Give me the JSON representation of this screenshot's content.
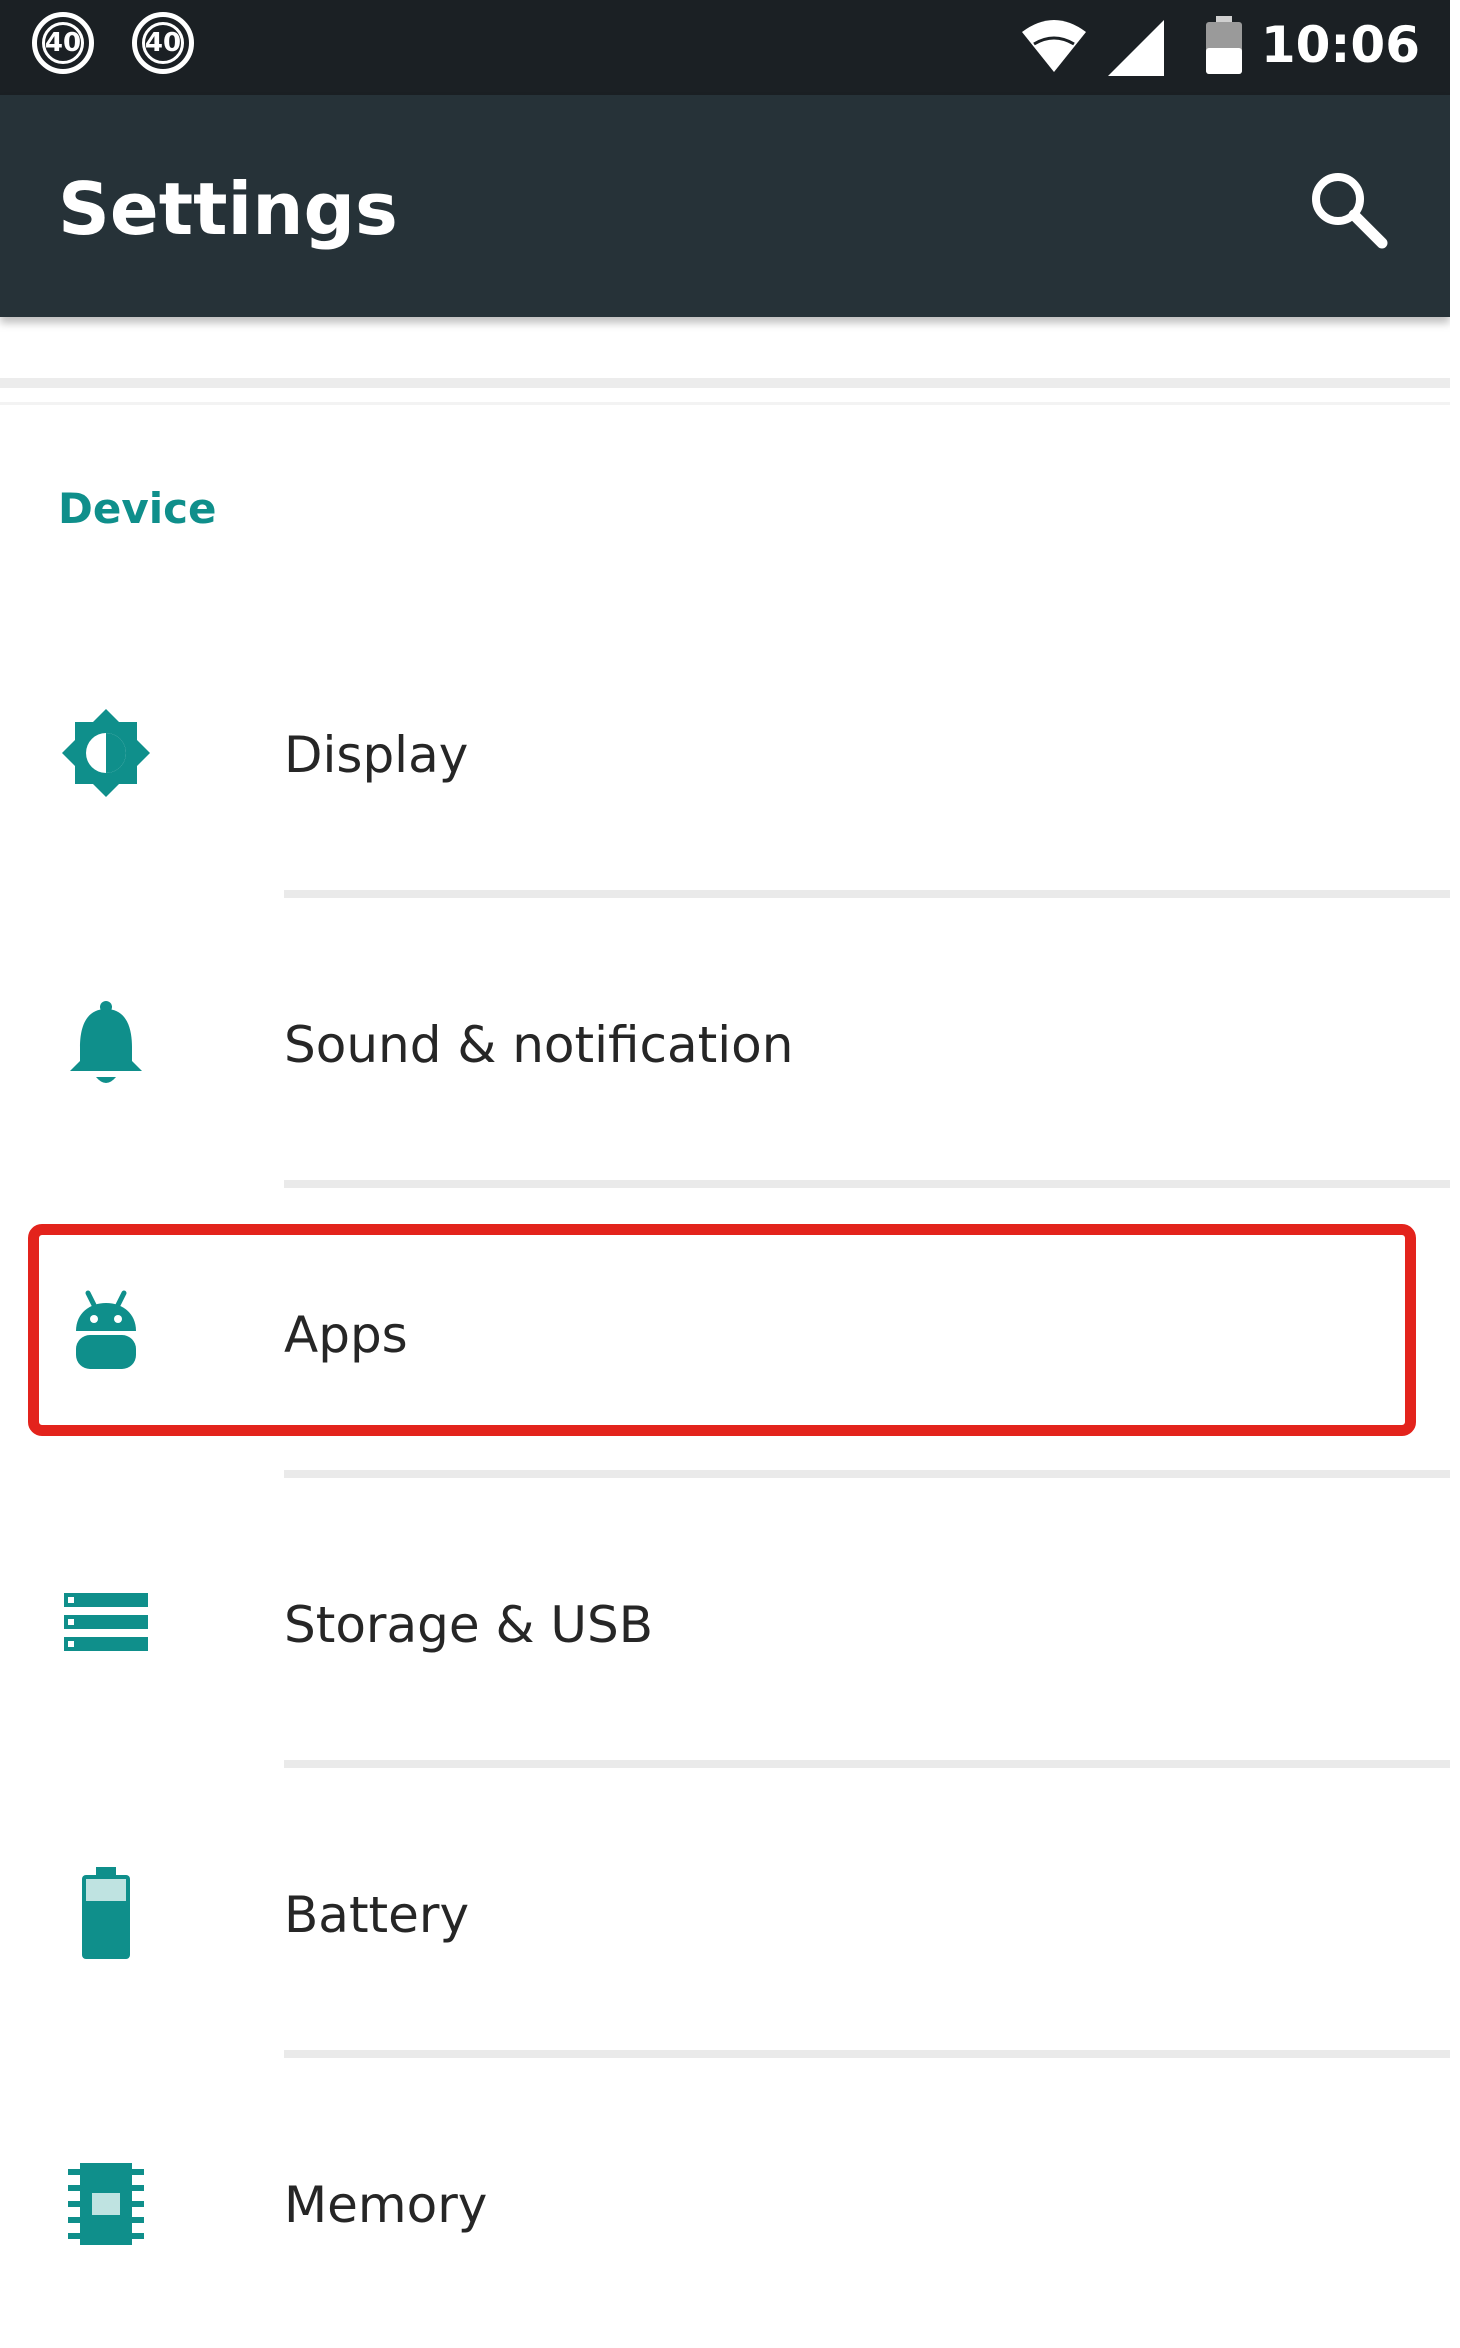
{
  "status_bar": {
    "badges": [
      "40",
      "40"
    ],
    "time": "10:06"
  },
  "app_bar": {
    "title": "Settings",
    "search_icon": "search-icon"
  },
  "section": {
    "header": "Device"
  },
  "items": [
    {
      "label": "Display",
      "icon": "brightness-icon"
    },
    {
      "label": "Sound & notification",
      "icon": "bell-icon"
    },
    {
      "label": "Apps",
      "icon": "android-icon"
    },
    {
      "label": "Storage & USB",
      "icon": "storage-icon"
    },
    {
      "label": "Battery",
      "icon": "battery-icon"
    },
    {
      "label": "Memory",
      "icon": "memory-chip-icon"
    }
  ],
  "colors": {
    "accent": "#0f8f8b",
    "app_bar": "#263238",
    "status_bar": "#1b2024",
    "highlight": "#e3231c"
  }
}
